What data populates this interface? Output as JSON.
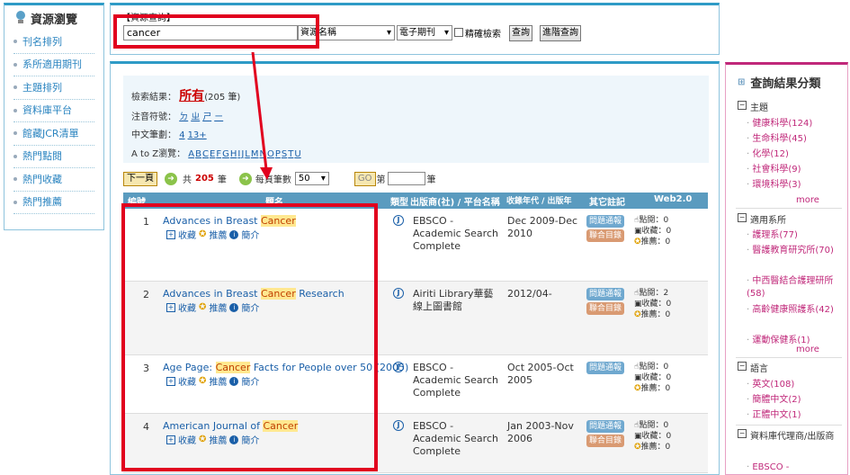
{
  "left_nav": {
    "title": "資源瀏覽",
    "items": [
      "刊名排列",
      "系所適用期刊",
      "主題排列",
      "資料庫平台",
      "館藏JCR清單",
      "熱門點閱",
      "熱門收藏",
      "熱門推薦"
    ]
  },
  "search": {
    "label": "【資源查詢】",
    "query": "cancer",
    "field_select": "資源名稱",
    "type_select": "電子期刊",
    "exact_label": "精確檢索",
    "search_button": "查詢",
    "advanced_button": "進階查詢"
  },
  "results_info": {
    "label": "檢索結果：",
    "scope": "所有",
    "count": "(205 筆)",
    "zhuyin_label": "注音符號：",
    "zhuyin": [
      "ㄉ",
      "ㄓ",
      "ㄕ",
      "ㄧ"
    ],
    "strokes_label": "中文筆劃：",
    "strokes": [
      "4",
      "13+"
    ],
    "az_label": "A to Z瀏覽：",
    "az": [
      "A",
      "B",
      "C",
      "E",
      "F",
      "G",
      "H",
      "I",
      "J",
      "L",
      "M",
      "N",
      "O",
      "P",
      "S",
      "T",
      "U"
    ]
  },
  "pager": {
    "next_button": "下一頁",
    "total_prefix": "共",
    "total": "205",
    "total_suffix": "筆",
    "per_page_label": "每頁筆數",
    "per_page": "50",
    "go_button": "GO",
    "page_prefix": "第",
    "page_suffix": "筆"
  },
  "table": {
    "headers": [
      "編號",
      "題名",
      "類型",
      "出版商(社) / 平台名稱",
      "收錄年代 / 出版年",
      "其它註記",
      "Web2.0"
    ],
    "actions": {
      "collect": "收藏",
      "recommend": "推薦",
      "intro": "簡介"
    },
    "badges": {
      "report": "問題通報",
      "union": "聯合目錄"
    },
    "rows": [
      {
        "num": "1",
        "title_pre": "Advances in Breast ",
        "title_hl": "Cancer",
        "title_post": "",
        "publisher": "EBSCO - Academic Search Complete",
        "years": "Dec 2009-Dec 2010",
        "union": true,
        "clicks": "點閱：0",
        "collects": "收藏：0",
        "recs": "推薦：0"
      },
      {
        "num": "2",
        "title_pre": "Advances in Breast ",
        "title_hl": "Cancer",
        "title_post": " Research",
        "publisher": "Airiti Library華藝線上圖書館",
        "years": "2012/04-",
        "union": true,
        "clicks": "點閱：2",
        "collects": "收藏：0",
        "recs": "推薦：0"
      },
      {
        "num": "3",
        "title_pre": "Age Page: ",
        "title_hl": "Cancer",
        "title_post": " Facts for People over 50 (2005)",
        "publisher": "EBSCO - Academic Search Complete",
        "years": "Oct 2005-Oct 2005",
        "union": false,
        "clicks": "點閱：0",
        "collects": "收藏：0",
        "recs": "推薦：0"
      },
      {
        "num": "4",
        "title_pre": "American Journal of ",
        "title_hl": "Cancer",
        "title_post": "",
        "publisher": "EBSCO - Academic Search Complete",
        "years": "Jan 2003-Nov 2006",
        "union": true,
        "clicks": "點閱：0",
        "collects": "收藏：0",
        "recs": "推薦：0"
      }
    ]
  },
  "facets": {
    "title": "查詢結果分類",
    "more": "more",
    "subject_title": "主題",
    "subject": [
      "健康科學(124)",
      "生命科學(45)",
      "化學(12)",
      "社會科學(9)",
      "環境科學(3)"
    ],
    "dept_title": "適用系所",
    "dept": [
      "護理系(77)",
      "醫護教育研究所(70)",
      "中西醫結合護理研所(58)",
      "高齡健康照護系(42)",
      "運動保健系(1)"
    ],
    "lang_title": "語言",
    "lang": [
      "英文(108)",
      "簡體中文(2)",
      "正體中文(1)"
    ],
    "agent_title": "資料庫代理商/出版商",
    "agent": [
      "EBSCO -"
    ]
  },
  "colors": {
    "accent": "#2e9bc6",
    "facet_accent": "#c0287a",
    "highlight": "#e1001e"
  }
}
